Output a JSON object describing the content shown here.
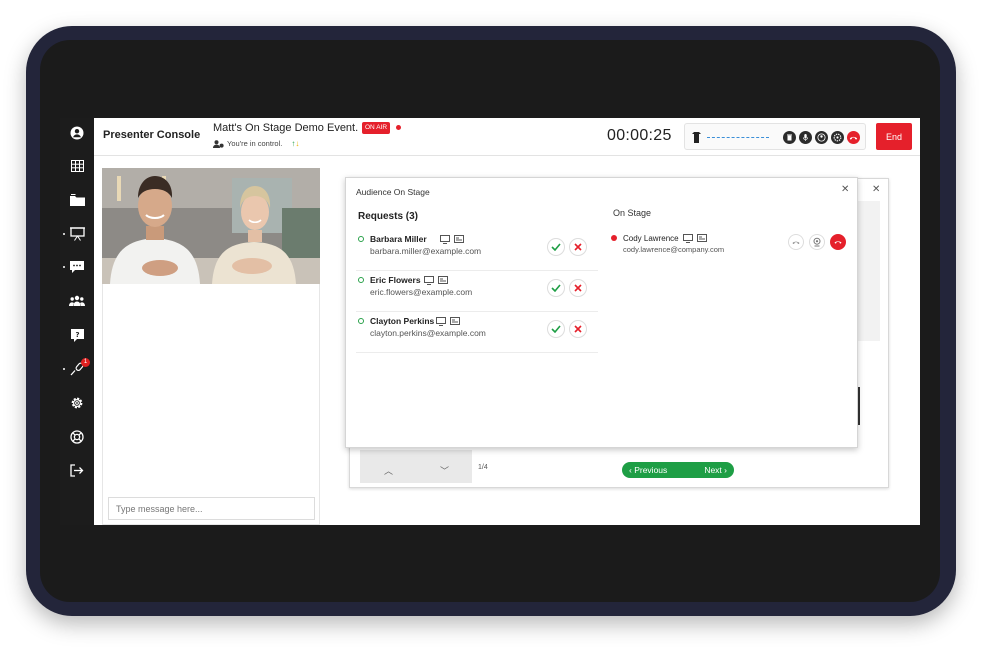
{
  "header": {
    "console_title": "Presenter Console",
    "event_title": "Matt's On Stage Demo Event.",
    "on_air_badge": "ON AIR",
    "control_text": "You're in control.",
    "timer": "00:00:25",
    "end_button": "End"
  },
  "sidebar": {
    "items": [
      {
        "icon": "user-circle-icon"
      },
      {
        "icon": "grid-icon"
      },
      {
        "icon": "folder-icon"
      },
      {
        "icon": "presentation-icon",
        "active": true
      },
      {
        "icon": "chat-bubble-icon",
        "active": true
      },
      {
        "icon": "users-group-icon"
      },
      {
        "icon": "question-icon"
      },
      {
        "icon": "microphone-icon",
        "active": true,
        "badge": "1"
      },
      {
        "icon": "settings-icon"
      },
      {
        "icon": "help-lifebuoy-icon"
      },
      {
        "icon": "logout-icon"
      }
    ]
  },
  "chat": {
    "placeholder": "Type message here..."
  },
  "modal": {
    "title": "Audience On Stage",
    "requests_title": "Requests (3)",
    "on_stage_title": "On Stage",
    "requests": [
      {
        "name": "Barbara Miller",
        "email": "barbara.miller@example.com"
      },
      {
        "name": "Eric Flowers",
        "email": "eric.flowers@example.com"
      },
      {
        "name": "Clayton Perkins",
        "email": "clayton.perkins@example.com"
      }
    ],
    "on_stage": [
      {
        "name": "Cody Lawrence",
        "email": "cody.lawrence@company.com"
      }
    ]
  },
  "slides": {
    "page": "1/4",
    "previous_label": "Previous",
    "next_label": "Next"
  },
  "colors": {
    "accent_red": "#e5202b",
    "accent_green": "#1e9e45",
    "sidebar_bg": "#1c1c1c",
    "device_frame": "#23253a"
  }
}
